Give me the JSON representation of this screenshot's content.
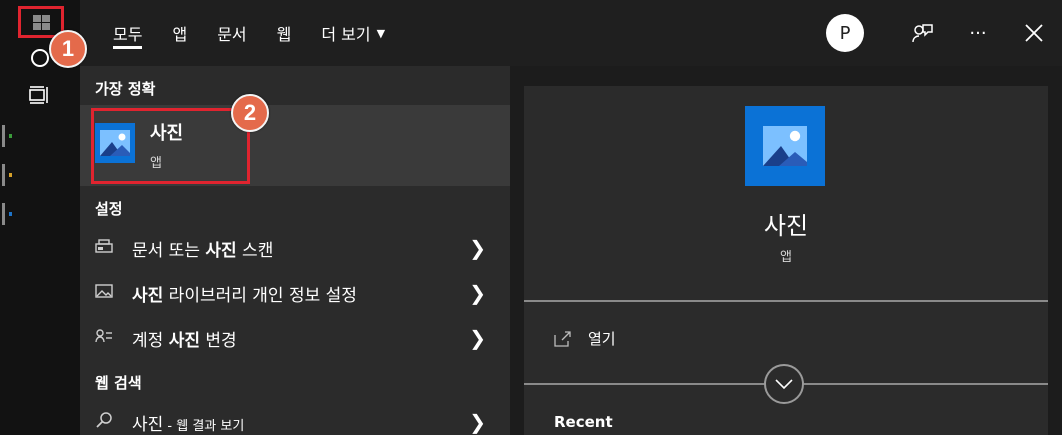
{
  "annotations": {
    "badge_1": "1",
    "badge_2": "2"
  },
  "header": {
    "tabs": [
      {
        "label": "모두"
      },
      {
        "label": "앱"
      },
      {
        "label": "문서"
      },
      {
        "label": "웹"
      },
      {
        "label": "더 보기"
      }
    ],
    "avatar_initial": "P",
    "colors": {
      "active_underline": "#ffffff"
    }
  },
  "results": {
    "best_match_header": "가장 정확",
    "best_match": {
      "title": "사진",
      "subtitle": "앱",
      "icon": "photos-app-icon"
    },
    "settings_header": "설정",
    "settings": [
      {
        "pre": "문서 또는 ",
        "bold": "사진",
        "post": " 스캔",
        "icon": "scanner-icon"
      },
      {
        "pre": "",
        "bold": "사진",
        "post": " 라이브러리 개인 정보 설정",
        "icon": "image-icon"
      },
      {
        "pre": "계정 ",
        "bold": "사진",
        "post": " 변경",
        "icon": "account-icon"
      }
    ],
    "web_header": "웹 검색",
    "web": {
      "query": "사진",
      "suffix": " - 웹 결과 보기",
      "icon": "search-icon"
    }
  },
  "preview": {
    "title": "사진",
    "subtitle": "앱",
    "open_label": "열기",
    "recent_label": "Recent"
  },
  "colors": {
    "highlight_box": "#e0242f",
    "badge": "#e46a4b",
    "app_blue": "#0b72d6"
  }
}
